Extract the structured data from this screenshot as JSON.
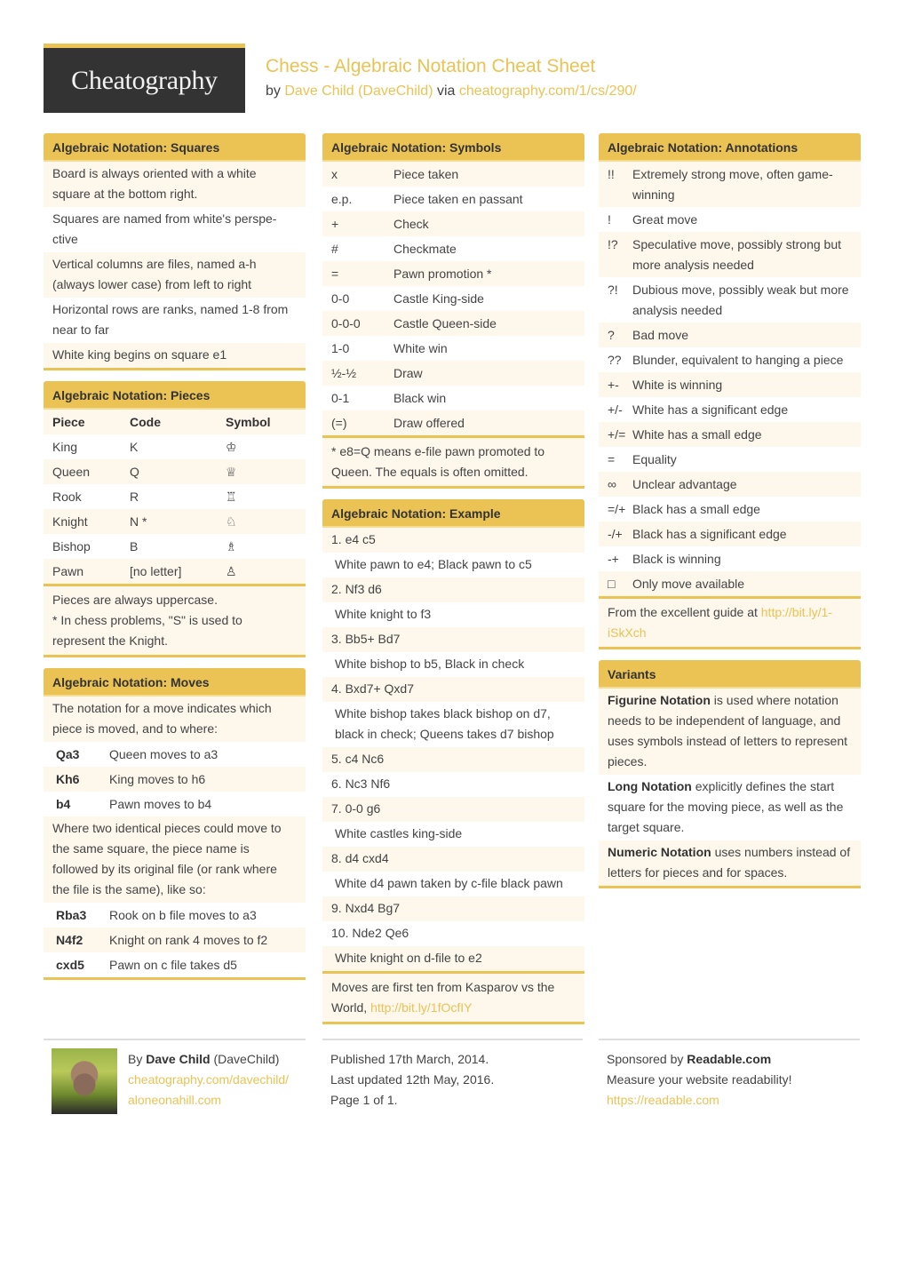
{
  "header": {
    "logo": "Cheatography",
    "title": "Chess - Algebraic Notation Cheat Sheet",
    "by": "by",
    "author": "Dave Child (DaveChild)",
    "via": "via",
    "url": "cheatography.com/1/cs/290/"
  },
  "squares": {
    "title": "Algebraic Notation: Squares",
    "items": [
      "Board is always oriented with a white square at the bottom right.",
      "Squares are named from white's perspe-ctive",
      "Vertical columns are files, named a-h (always lower case) from left to right",
      "Horizontal rows are ranks, named 1-8 from near to far",
      "White king begins on square e1"
    ]
  },
  "pieces": {
    "title": "Algebraic Notation: Pieces",
    "headers": [
      "Piece",
      "Code",
      "Symbol"
    ],
    "rows": [
      [
        "King",
        "K",
        "♔"
      ],
      [
        "Queen",
        "Q",
        "♕"
      ],
      [
        "Rook",
        "R",
        "♖"
      ],
      [
        "Knight",
        "N *",
        "♘"
      ],
      [
        "Bishop",
        "B",
        "♗"
      ],
      [
        "Pawn",
        "[no letter]",
        "♙"
      ]
    ],
    "note1": "Pieces are always uppercase.",
    "note2": "* In chess problems, \"S\" is used to represent the Knight."
  },
  "moves": {
    "title": "Algebraic Notation: Moves",
    "intro": "The notation for a move indicates which piece is moved, and to where:",
    "rows1": [
      [
        "Qa3",
        "Queen moves to a3"
      ],
      [
        "Kh6",
        "King moves to h6"
      ],
      [
        "b4",
        "Pawn moves to b4"
      ]
    ],
    "middle": "Where two identical pieces could move to the same square, the piece name is followed by its original file (or rank where the file is the same), like so:",
    "rows2": [
      [
        "Rba3",
        "Rook on b file moves to a3"
      ],
      [
        "N4f2",
        "Knight on rank 4 moves to f2"
      ],
      [
        "cxd5",
        "Pawn on c file takes d5"
      ]
    ]
  },
  "symbols": {
    "title": "Algebraic Notation: Symbols",
    "rows": [
      [
        "x",
        "Piece taken"
      ],
      [
        "e.p.",
        "Piece taken en passant"
      ],
      [
        "+",
        "Check"
      ],
      [
        "#",
        "Checkmate"
      ],
      [
        "=",
        "Pawn promotion *"
      ],
      [
        "0-0",
        "Castle King-side"
      ],
      [
        "0-0-0",
        "Castle Queen-side"
      ],
      [
        "1-0",
        "White win"
      ],
      [
        "½-½",
        "Draw"
      ],
      [
        "0-1",
        "Black win"
      ],
      [
        "(=)",
        "Draw offered"
      ]
    ],
    "note": "* e8=Q means e-file pawn promoted to Queen. The equals is often omitted."
  },
  "example": {
    "title": "Algebraic Notation: Example",
    "items": [
      {
        "move": "1. e4 c5",
        "desc": "White pawn to e4; Black pawn to c5"
      },
      {
        "move": "2. Nf3 d6",
        "desc": "White knight to f3"
      },
      {
        "move": "3. Bb5+ Bd7",
        "desc": "White bishop to b5, Black in check"
      },
      {
        "move": "4. Bxd7+ Qxd7",
        "desc": "White bishop takes black bishop on d7, black in check; Queens takes d7 bishop"
      },
      {
        "move": "5. c4 Nc6",
        "desc": ""
      },
      {
        "move": "6. Nc3 Nf6",
        "desc": ""
      },
      {
        "move": "7. 0-0 g6",
        "desc": "White castles king-side"
      },
      {
        "move": "8. d4 cxd4",
        "desc": "White d4 pawn taken by c-file black pawn"
      },
      {
        "move": "9. Nxd4 Bg7",
        "desc": ""
      },
      {
        "move": "10. Nde2 Qe6",
        "desc": "White knight on d-file to e2"
      }
    ],
    "note": "Moves are first ten from Kasparov vs the World,",
    "note_link": "http://bit.ly/1fOcfIY"
  },
  "annotations": {
    "title": "Algebraic Notation: Annotations",
    "rows": [
      [
        "!!",
        "Extremely strong move, often game-winning"
      ],
      [
        "!",
        "Great move"
      ],
      [
        "!?",
        "Speculative move, possibly strong but more analysis needed"
      ],
      [
        "?!",
        "Dubious move, possibly weak but more analysis needed"
      ],
      [
        "?",
        "Bad move"
      ],
      [
        "??",
        "Blunder, equivalent to hanging a piece"
      ],
      [
        "+-",
        "White is winning"
      ],
      [
        "+/-",
        "White has a significant edge"
      ],
      [
        "+/=",
        "White has a small edge"
      ],
      [
        "=",
        "Equality"
      ],
      [
        "∞",
        "Unclear advantage"
      ],
      [
        "=/+",
        "Black has a small edge"
      ],
      [
        "-/+",
        "Black has a significant edge"
      ],
      [
        "-+",
        "Black is winning"
      ],
      [
        "□",
        "Only move available"
      ]
    ],
    "note": "From the excellent guide at",
    "note_link": "http://bit.ly/1-iSkXch"
  },
  "variants": {
    "title": "Variants",
    "items": [
      {
        "bold": "Figurine Notation",
        "text": " is used where notation needs to be independent of language, and uses symbols instead of letters to represent pieces."
      },
      {
        "bold": "Long Notation",
        "text": " explicitly defines the start square for the moving piece, as well as the target square."
      },
      {
        "bold": "Numeric Notation",
        "text": " uses numbers instead of letters for pieces and for spaces."
      }
    ]
  },
  "footer": {
    "by": "By",
    "author_name": "Dave Child",
    "author_handle": "(DaveChild)",
    "author_link1": "cheatography.com/davechild/",
    "author_link2": "aloneonahill.com",
    "published": "Published 17th March, 2014.",
    "updated": "Last updated 12th May, 2016.",
    "page": "Page 1 of 1.",
    "sponsored_by": "Sponsored by",
    "sponsor": "Readable.com",
    "sponsor_tagline": "Measure your website readability!",
    "sponsor_link": "https://readable.com"
  },
  "colors": {
    "accent": "#EBC254",
    "row_alt": "#FDF7EC",
    "logo_bg": "#333333",
    "text": "#444444"
  }
}
